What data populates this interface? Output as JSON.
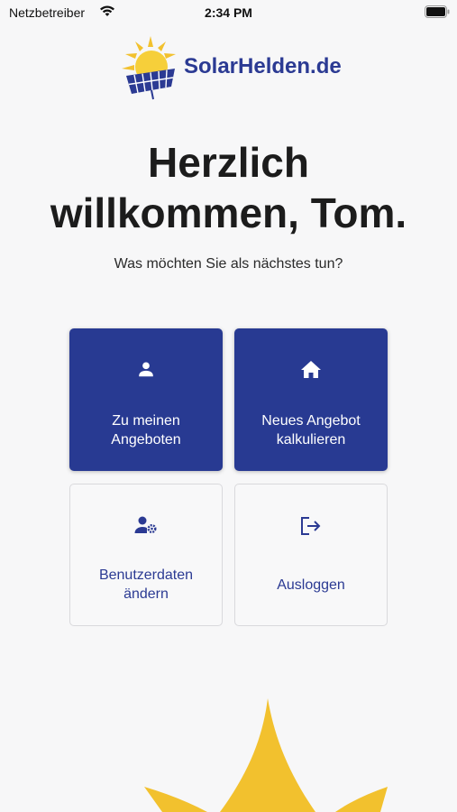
{
  "status_bar": {
    "carrier": "Netzbetreiber",
    "time": "2:34 PM"
  },
  "brand": {
    "name": "SolarHelden.de",
    "primary_color": "#283a92",
    "accent_color": "#f2c12e"
  },
  "welcome": {
    "title_line1": "Herzlich",
    "title_line2": "willkommen, Tom.",
    "subtitle": "Was möchten Sie als nächstes tun?"
  },
  "actions": [
    {
      "label_line1": "Zu meinen",
      "label_line2": "Angeboten",
      "icon": "person-icon",
      "style": "primary"
    },
    {
      "label_line1": "Neues Angebot",
      "label_line2": "kalkulieren",
      "icon": "home-icon",
      "style": "primary"
    },
    {
      "label_line1": "Benutzerdaten",
      "label_line2": "ändern",
      "icon": "user-settings-icon",
      "style": "secondary"
    },
    {
      "label_line1": "Ausloggen",
      "icon": "logout-icon",
      "style": "secondary"
    }
  ]
}
